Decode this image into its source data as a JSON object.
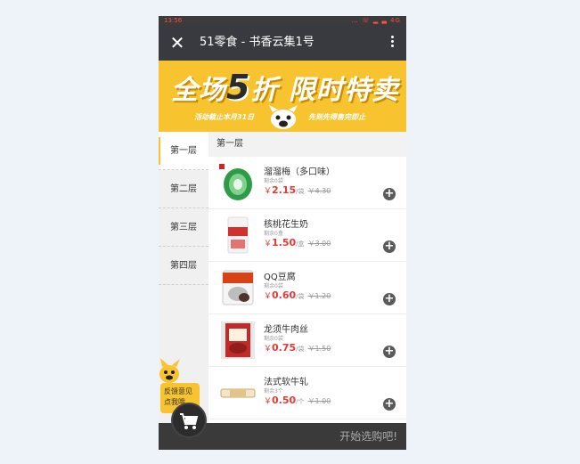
{
  "status_bar": {
    "time": "13:56",
    "icons_text": "… ☏ ▂ ▃ 4G"
  },
  "title_bar": {
    "close_symbol": "✕",
    "title": "51零食 - 书香云集1号"
  },
  "banner": {
    "headline_a": "全场",
    "headline_five": "5",
    "headline_b": "折 限时特卖",
    "sub_left": "活动截止本月31日",
    "sub_right": "先到先得售完即止"
  },
  "nav": {
    "items": [
      {
        "label": "第一层",
        "active": true
      },
      {
        "label": "第二层",
        "active": false
      },
      {
        "label": "第三层",
        "active": false
      },
      {
        "label": "第四层",
        "active": false
      }
    ]
  },
  "section": {
    "title": "第一层"
  },
  "products": [
    {
      "name": "溜溜梅（多口味）",
      "stock": "剩余0袋",
      "yen": "￥",
      "price": "2.15",
      "unit": "/袋",
      "original": "￥4.30"
    },
    {
      "name": "核桃花生奶",
      "stock": "剩余0盒",
      "yen": "￥",
      "price": "1.50",
      "unit": "/盒",
      "original": "￥3.00"
    },
    {
      "name": "QQ豆腐",
      "stock": "剩余0袋",
      "yen": "￥",
      "price": "0.60",
      "unit": "/袋",
      "original": "￥1.20"
    },
    {
      "name": "龙须牛肉丝",
      "stock": "剩余0袋",
      "yen": "￥",
      "price": "0.75",
      "unit": "/袋",
      "original": "￥1.50"
    },
    {
      "name": "法式软牛轧",
      "stock": "剩余3个",
      "yen": "￥",
      "price": "0.50",
      "unit": "/个",
      "original": "￥1.00"
    }
  ],
  "add_symbol": "+",
  "feedback": {
    "line1": "反馈意见",
    "line2": "点我哦"
  },
  "bottom_bar": {
    "cta": "开始选购吧!"
  },
  "colors": {
    "accent": "#f7c32e",
    "price": "#e53935",
    "title_bar": "#393a3f"
  }
}
